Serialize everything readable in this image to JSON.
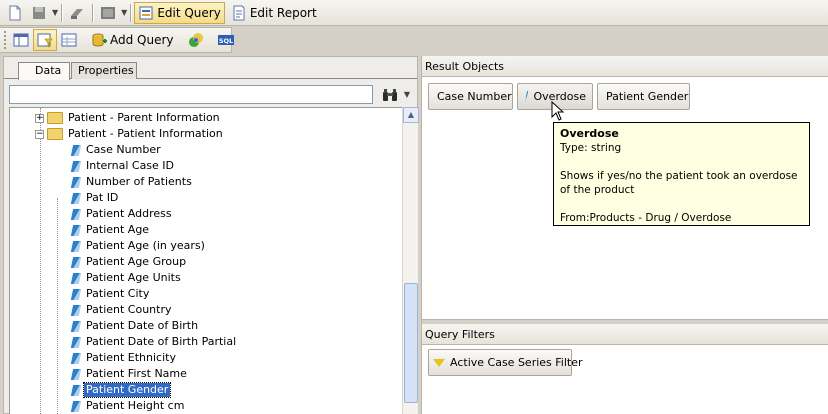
{
  "toolbar": {
    "edit_query": "Edit Query",
    "edit_report": "Edit Report",
    "add_query": "Add Query"
  },
  "left_panel": {
    "tabs": [
      "Data",
      "Properties"
    ],
    "search_value": "",
    "tree": {
      "folders": [
        "Patient - Parent Information",
        "Patient - Patient Information"
      ],
      "items": [
        "Case Number",
        "Internal Case ID",
        "Number of Patients",
        "Pat ID",
        "Patient Address",
        "Patient Age",
        "Patient Age (in years)",
        "Patient Age Group",
        "Patient Age Units",
        "Patient City",
        "Patient Country",
        "Patient Date of Birth",
        "Patient Date of Birth Partial",
        "Patient Ethnicity",
        "Patient First Name",
        "Patient Gender",
        "Patient Height cm"
      ],
      "selected_item": "Patient Gender"
    }
  },
  "result_objects": {
    "title": "Result Objects",
    "items": [
      "Case Number",
      "Overdose",
      "Patient Gender"
    ]
  },
  "tooltip": {
    "title": "Overdose",
    "type": "Type: string",
    "description": "Shows if yes/no the patient took an overdose of the product",
    "from": "From:Products - Drug / Overdose"
  },
  "query_filters": {
    "title": "Query Filters",
    "items": [
      "Active Case Series Filter"
    ]
  }
}
